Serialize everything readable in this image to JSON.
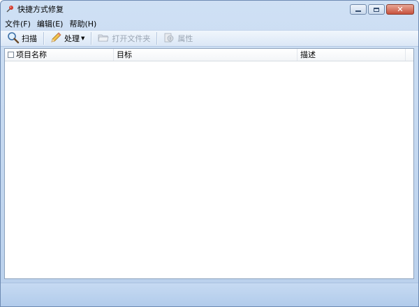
{
  "window": {
    "title": "快捷方式修复"
  },
  "menubar": {
    "items": [
      {
        "label": "文件(F)"
      },
      {
        "label": "编辑(E)"
      },
      {
        "label": "帮助(H)"
      }
    ]
  },
  "toolbar": {
    "scan_label": "扫描",
    "process_label": "处理",
    "open_folder_label": "打开文件夹",
    "properties_label": "属性"
  },
  "list": {
    "columns": [
      {
        "label": "项目名称"
      },
      {
        "label": "目标"
      },
      {
        "label": "描述"
      }
    ],
    "rows": []
  },
  "colors": {
    "accent": "#cfe0f4",
    "close_button": "#c7513d"
  },
  "icons": {
    "app": "pin-icon",
    "scan": "magnifier-icon",
    "process": "pencil-icon",
    "open_folder": "folder-icon",
    "properties": "properties-icon"
  }
}
